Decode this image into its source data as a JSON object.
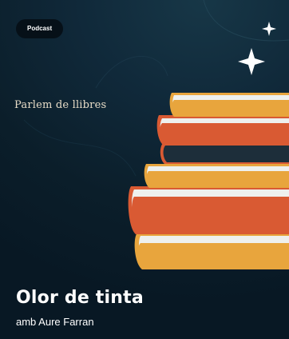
{
  "badge": {
    "label": "Podcast"
  },
  "podcast": {
    "overline": "Parlem de llibres",
    "title": "Olor de tinta",
    "subtitle": "amb Aure Farran"
  },
  "icons": [
    "sparkle-icon",
    "books-illustration"
  ],
  "colors": {
    "background": "#0b1f2b",
    "book_orange": "#e8a53d",
    "book_red": "#d95a33",
    "page_white": "#eef0ee",
    "text": "#ffffff"
  }
}
